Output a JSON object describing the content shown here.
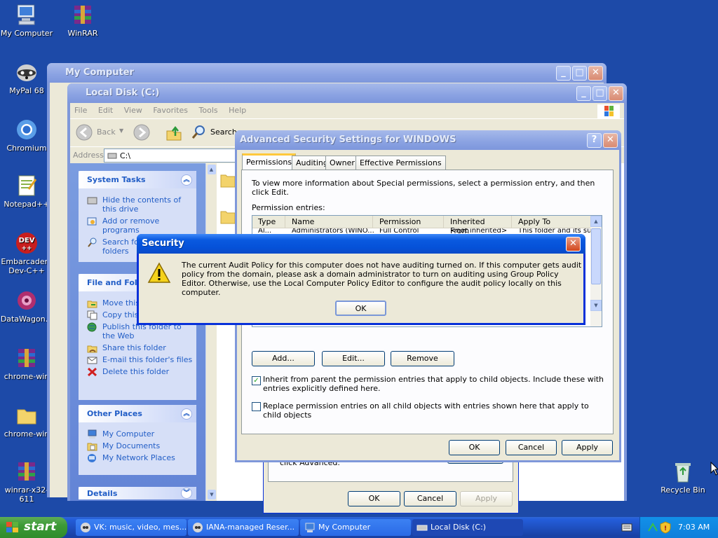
{
  "colors": {
    "desktop": "#1d4aa8",
    "xp_blue_title": "#0a5ae0",
    "link_blue": "#215dc6"
  },
  "desktop_icons": [
    {
      "label": "My Computer",
      "icon": "computer-icon"
    },
    {
      "label": "WinRAR",
      "icon": "winrar-icon"
    },
    {
      "label": "MyPal 68",
      "icon": "raccoon-icon"
    },
    {
      "label": "Chromium",
      "icon": "chromium-icon"
    },
    {
      "label": "Notepad++",
      "icon": "notepad-icon"
    },
    {
      "label": "Embarcadero Dev-C++",
      "icon": "devcpp-icon"
    },
    {
      "label": "DataWagon...",
      "icon": "datawagon-icon"
    },
    {
      "label": "chrome-win",
      "icon": "winrar-icon"
    },
    {
      "label": "chrome-win",
      "icon": "folder-icon"
    },
    {
      "label": "winrar-x32-611",
      "icon": "winrar-icon"
    },
    {
      "label": "Recycle Bin",
      "icon": "recycle-bin-icon"
    }
  ],
  "my_computer_window": {
    "title": "My Computer"
  },
  "local_disk_window": {
    "title": "Local Disk (C:)",
    "menu": [
      "File",
      "Edit",
      "View",
      "Favorites",
      "Tools",
      "Help"
    ],
    "toolbar": {
      "back": "Back",
      "search": "Search"
    },
    "address_label": "Address",
    "address_value": "C:\\",
    "system_tasks": {
      "title": "System Tasks",
      "items": [
        "Hide the contents of this drive",
        "Add or remove programs",
        "Search for files or folders"
      ]
    },
    "file_folder_tasks": {
      "title": "File and Folder Tasks",
      "items": [
        "Move this folder",
        "Copy this folder",
        "Publish this folder to the Web",
        "Share this folder",
        "E-mail this folder's files",
        "Delete this folder"
      ]
    },
    "other_places": {
      "title": "Other Places",
      "items": [
        "My Computer",
        "My Documents",
        "My Network Places"
      ]
    },
    "details": {
      "title": "Details"
    }
  },
  "security_props_window": {
    "text_fragment": "click Advanced.",
    "buttons": {
      "ok": "OK",
      "cancel": "Cancel",
      "apply": "Apply"
    }
  },
  "advanced_window": {
    "title": "Advanced Security Settings for WINDOWS",
    "tabs": [
      "Permissions",
      "Auditing",
      "Owner",
      "Effective Permissions"
    ],
    "info": "To view more information about Special permissions, select a permission entry, and then click Edit.",
    "entries_label": "Permission entries:",
    "columns": [
      "Type",
      "Name",
      "Permission",
      "Inherited From",
      "Apply To"
    ],
    "row_fragments": [
      "Al...",
      "Administrators (WINO...",
      "Full Control",
      "<not inherited>",
      "This folder and its subfolders and files"
    ],
    "buttons": {
      "add": "Add...",
      "edit": "Edit...",
      "remove": "Remove",
      "ok": "OK",
      "cancel": "Cancel",
      "apply": "Apply"
    },
    "inherit_checkbox": {
      "checked": true,
      "label": "Inherit from parent the permission entries that apply to child objects. Include these with entries explicitly defined here."
    },
    "replace_checkbox": {
      "checked": false,
      "label": "Replace permission entries on all child objects with entries shown here that apply to child objects"
    }
  },
  "security_dialog": {
    "title": "Security",
    "message": "The current Audit Policy for this computer does not have auditing turned on.  If this computer gets audit policy from the domain, please ask a domain administrator to turn on auditing using Group Policy Editor.  Otherwise, use the Local Computer Policy Editor to configure the audit policy locally on this computer.",
    "ok": "OK"
  },
  "taskbar": {
    "start": "start",
    "tasks": [
      "VK: music, video, mes...",
      "IANA-managed Reser...",
      "My Computer",
      "Local Disk (C:)"
    ],
    "active_task": "Local Disk (C:)",
    "clock": "7:03 AM"
  }
}
